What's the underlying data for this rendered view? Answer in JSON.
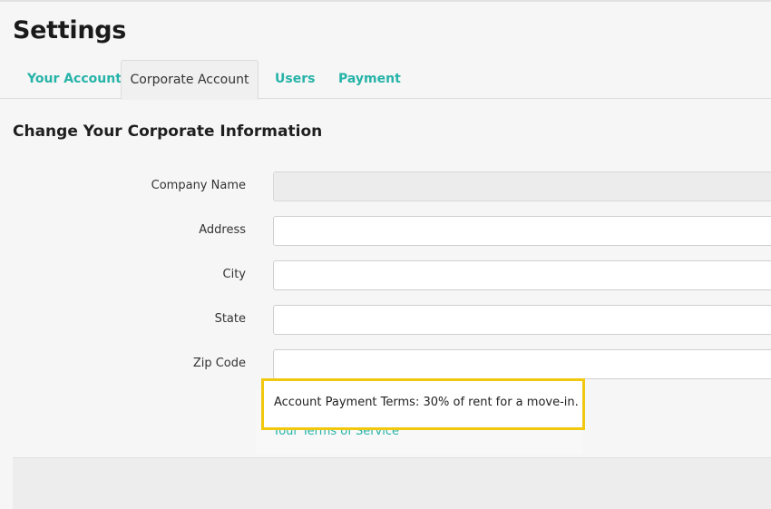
{
  "page": {
    "title": "Settings"
  },
  "tabs": [
    {
      "label": "Your Account",
      "active": false
    },
    {
      "label": "Corporate Account",
      "active": true
    },
    {
      "label": "Users",
      "active": false
    },
    {
      "label": "Payment",
      "active": false
    }
  ],
  "section": {
    "title": "Change Your Corporate Information"
  },
  "form": {
    "company_name": {
      "label": "Company Name",
      "value": ""
    },
    "address": {
      "label": "Address",
      "value": ""
    },
    "city": {
      "label": "City",
      "value": ""
    },
    "state": {
      "label": "State",
      "value": ""
    },
    "zip": {
      "label": "Zip Code",
      "value": ""
    }
  },
  "terms": {
    "link": "Your Terms of Service",
    "payment_terms": "Account Payment Terms: 30% of rent for a move-in."
  },
  "colors": {
    "accent": "#26b3a8",
    "highlight_border": "#f2c80f"
  }
}
